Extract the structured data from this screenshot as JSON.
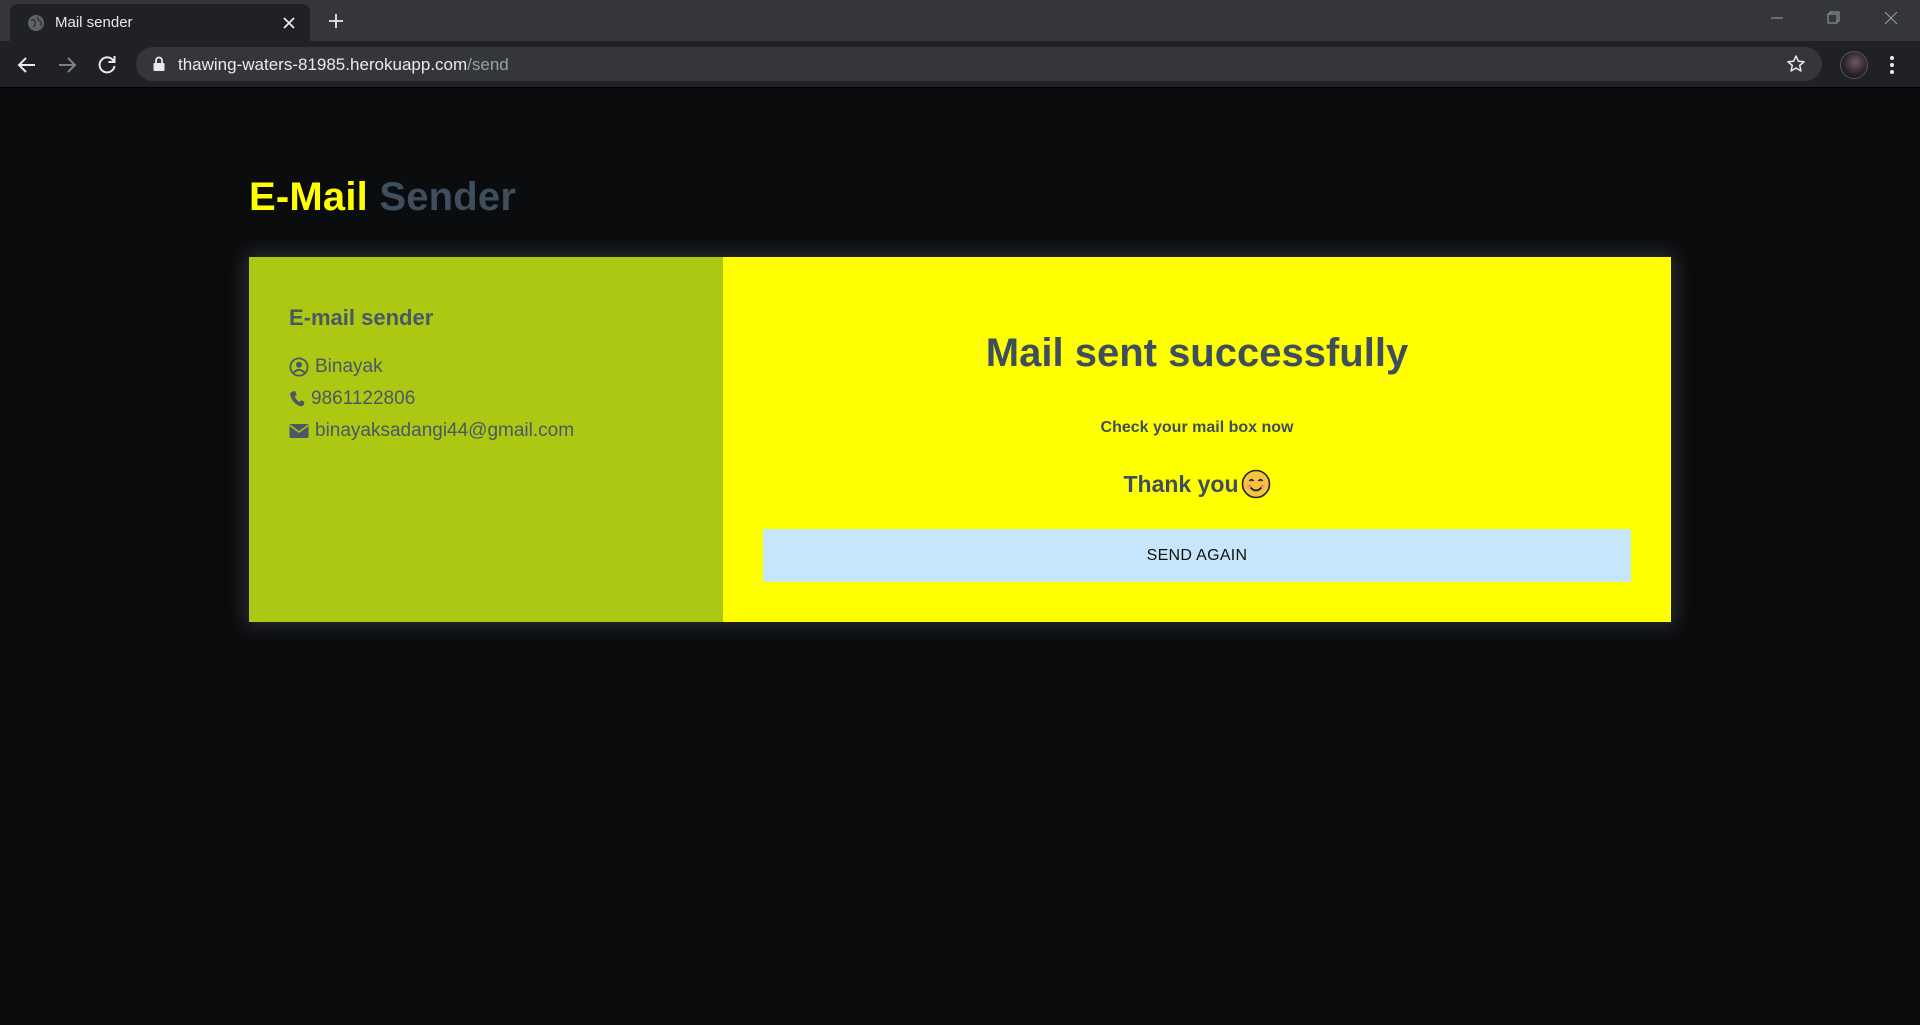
{
  "browser": {
    "tab_title": "Mail sender",
    "url_host": "thawing-waters-81985.herokuapp.com",
    "url_path": "/send"
  },
  "page": {
    "brand_part1": "E-Mail",
    "brand_part2": "Sender",
    "colors": {
      "brand_yellow": "#ffff00",
      "brand_slate": "#3f4e5c",
      "left_panel": "#adc812",
      "right_panel": "#ffff00",
      "button_bg": "#c7e5fb"
    },
    "sender_info": {
      "title": "E-mail sender",
      "name": "Binayak",
      "phone": "9861122806",
      "email": "binayaksadangi44@gmail.com",
      "icons": [
        "user-circle-icon",
        "phone-icon",
        "envelope-icon"
      ]
    },
    "result": {
      "heading": "Mail sent successfully",
      "subtext": "Check your mail box now",
      "thanks": "Thank you",
      "button_label": "SEND AGAIN"
    }
  }
}
